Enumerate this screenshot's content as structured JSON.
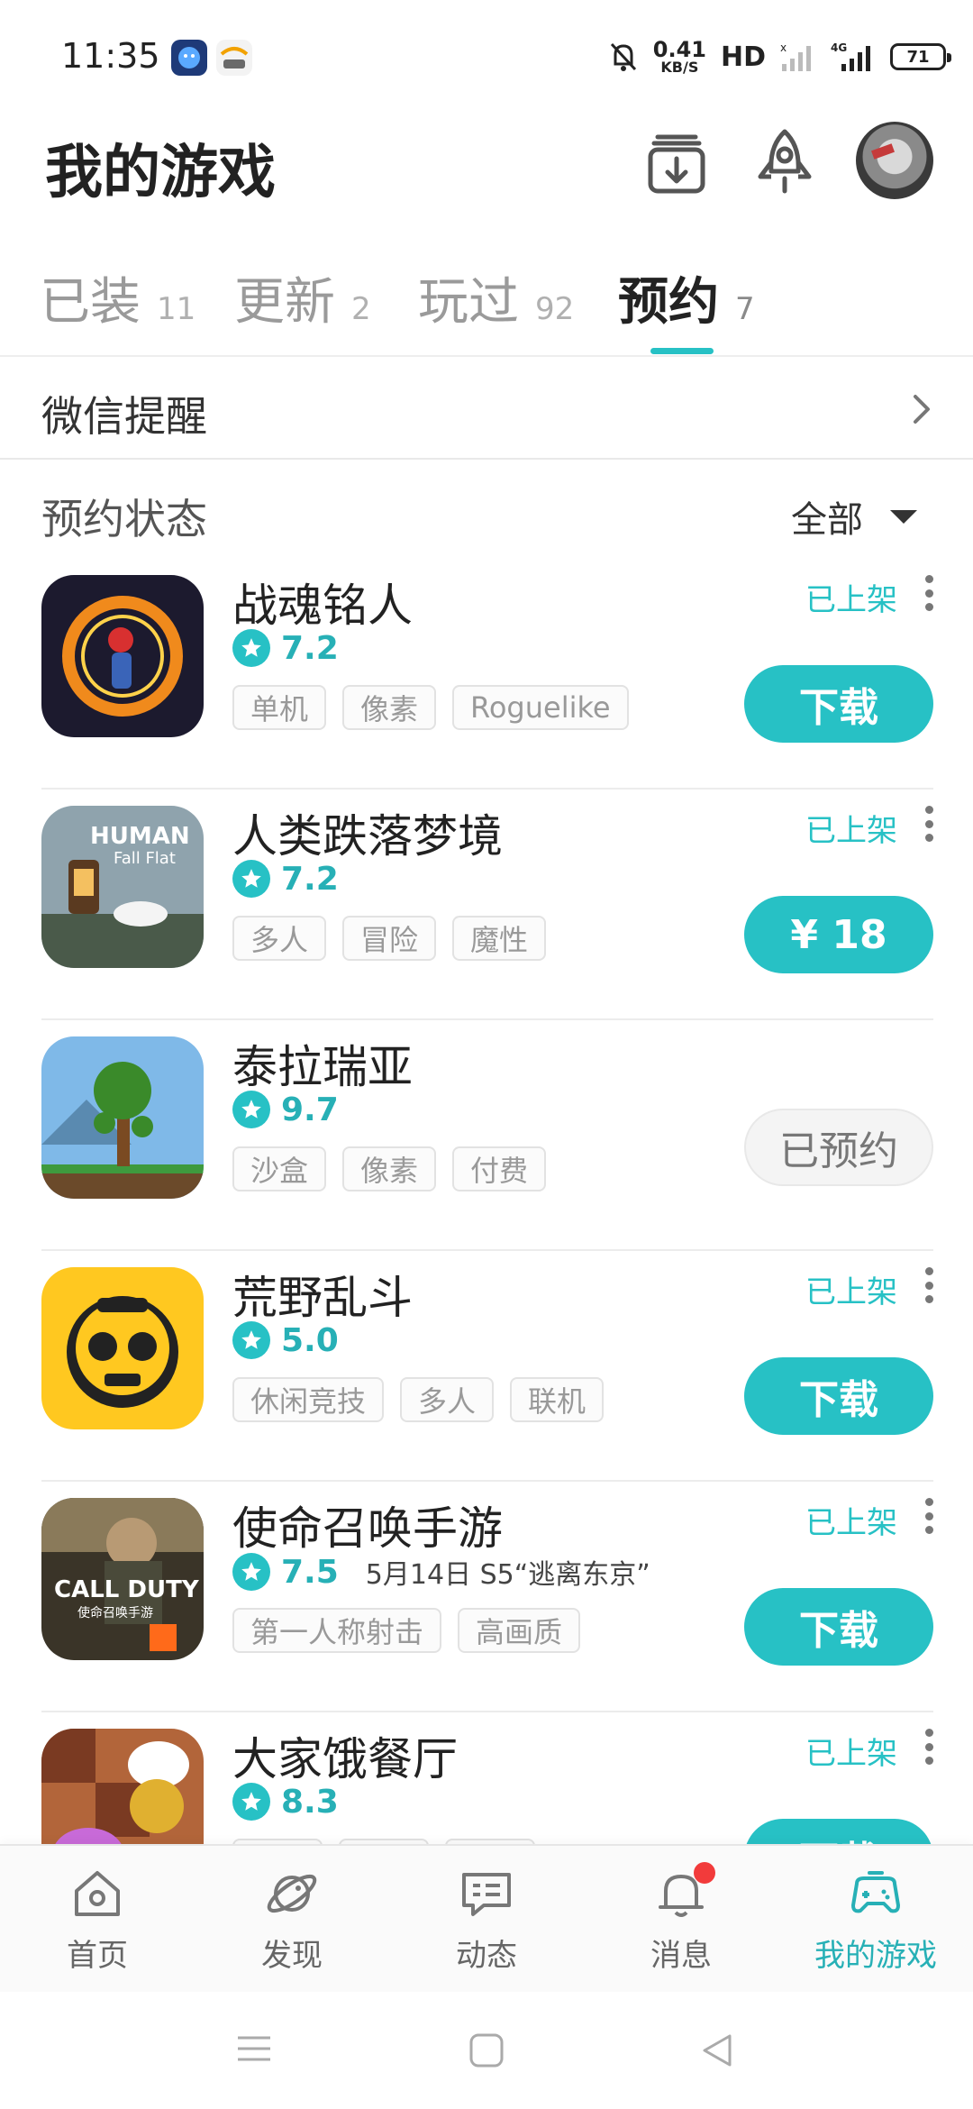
{
  "status_bar": {
    "time": "11:35",
    "net_speed_value": "0.41",
    "net_speed_unit": "KB/S",
    "hd": "HD",
    "battery": "71",
    "icons": [
      "app-icon-1",
      "app-icon-2",
      "mute-icon",
      "signal-icon",
      "4g-signal-icon",
      "battery-icon"
    ]
  },
  "header": {
    "title": "我的游戏",
    "icons": [
      "download-manager-icon",
      "rocket-icon",
      "avatar"
    ]
  },
  "tabs": [
    {
      "label": "已装",
      "count": "11"
    },
    {
      "label": "更新",
      "count": "2"
    },
    {
      "label": "玩过",
      "count": "92"
    },
    {
      "label": "预约",
      "count": "7"
    }
  ],
  "wechat": {
    "label": "微信提醒"
  },
  "filter": {
    "title": "预约状态",
    "selected": "全部"
  },
  "games": [
    {
      "name": "战魂铭人",
      "score": "7.2",
      "event": "",
      "tags": [
        "单机",
        "像素",
        "Roguelike"
      ],
      "status": "已上架",
      "button": "下载"
    },
    {
      "name": "人类跌落梦境",
      "score": "7.2",
      "event": "",
      "tags": [
        "多人",
        "冒险",
        "魔性"
      ],
      "status": "已上架",
      "button": "¥ 18"
    },
    {
      "name": "泰拉瑞亚",
      "score": "9.7",
      "event": "",
      "tags": [
        "沙盒",
        "像素",
        "付费"
      ],
      "status": "",
      "button": "已预约"
    },
    {
      "name": "荒野乱斗",
      "score": "5.0",
      "event": "",
      "tags": [
        "休闲竞技",
        "多人",
        "联机"
      ],
      "status": "已上架",
      "button": "下载"
    },
    {
      "name": "使命召唤手游",
      "score": "7.5",
      "event": "5月14日 S5“逃离东京”",
      "tags": [
        "第一人称射击",
        "高画质"
      ],
      "status": "已上架",
      "button": "下载"
    },
    {
      "name": "大家饿餐厅",
      "score": "8.3",
      "event": "",
      "tags": [
        "",
        "",
        ""
      ],
      "status": "已上架",
      "button": "下载"
    }
  ],
  "bottom_nav": [
    {
      "label": "首页",
      "icon": "home-icon"
    },
    {
      "label": "发现",
      "icon": "planet-icon"
    },
    {
      "label": "动态",
      "icon": "chat-icon"
    },
    {
      "label": "消息",
      "icon": "bell-icon"
    },
    {
      "label": "我的游戏",
      "icon": "gamepad-icon"
    }
  ],
  "colors": {
    "accent": "#27c1c5",
    "badge": "#f23b3b"
  }
}
